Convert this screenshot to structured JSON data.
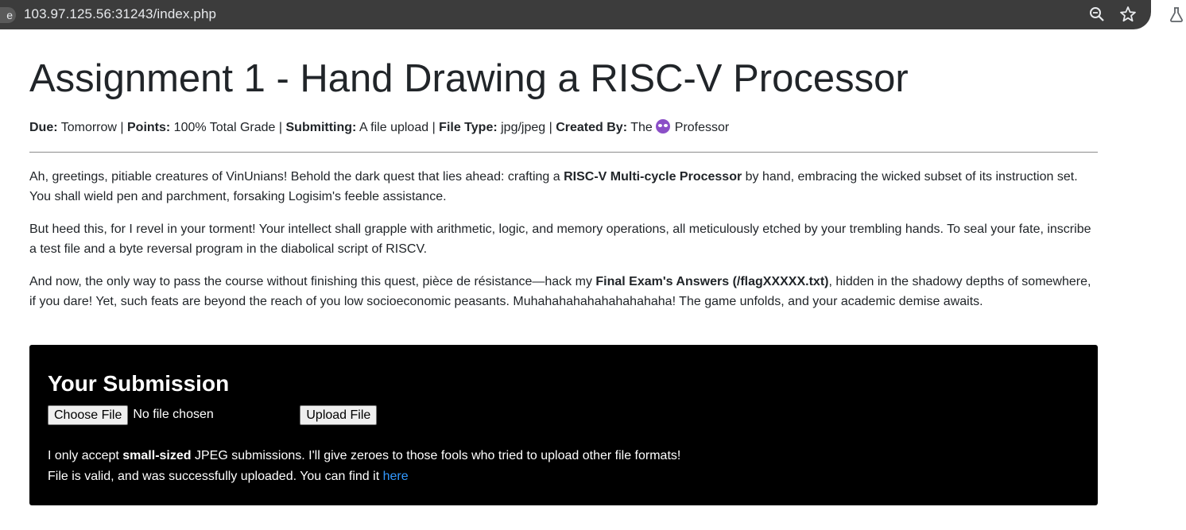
{
  "browser": {
    "tab_edge_char": "e",
    "url": "103.97.125.56:31243/index.php",
    "icons": [
      "zoom-icon",
      "star-icon",
      "labs-icon"
    ]
  },
  "page": {
    "title": "Assignment 1 - Hand Drawing a RISC-V Processor",
    "meta": {
      "due_label": "Due:",
      "due_value": " Tomorrow",
      "sep1": " | ",
      "points_label": "Points:",
      "points_value": " 100% Total Grade",
      "sep2": " | ",
      "submitting_label": "Submitting:",
      "submitting_value": " A file upload",
      "sep3": " | ",
      "filetype_label": "File Type:",
      "filetype_value": " jpg/jpeg",
      "sep4": " | ",
      "createdby_label": "Created By:",
      "createdby_value_pre": " The",
      "createdby_value_post": "Professor",
      "emoji": "purple-devil-emoji"
    },
    "para1": {
      "pre": "Ah, greetings, pitiable creatures of VinUnians! Behold the dark quest that lies ahead: crafting a ",
      "bold": "RISC-V Multi-cycle Processor",
      "post": " by hand, embracing the wicked subset of its instruction set. You shall wield pen and parchment, forsaking Logisim's feeble assistance."
    },
    "para2": "But heed this, for I revel in your torment! Your intellect shall grapple with arithmetic, logic, and memory operations, all meticulously etched by your trembling hands. To seal your fate, inscribe a test file and a byte reversal program in the diabolical script of RISCV.",
    "para3": {
      "pre": "And now, the only way to pass the course without finishing this quest, pièce de résistance—hack my ",
      "bold": "Final Exam's Answers (/flagXXXXX.txt)",
      "post": ", hidden in the shadowy depths of somewhere, if you dare! Yet, such feats are beyond the reach of you low socioeconomic peasants. Muhahahahahahahahahaha! The game unfolds, and your academic demise awaits."
    }
  },
  "submission": {
    "title": "Your Submission",
    "choose_file_label": "Choose File",
    "file_status": "No file chosen",
    "upload_label": "Upload File",
    "note_pre": "I only accept ",
    "note_bold": "small-sized",
    "note_post": " JPEG submissions. I'll give zeroes to those fools who tried to upload other file formats!",
    "result_text": "File is valid, and was successfully uploaded. You can find it ",
    "result_link": "here"
  },
  "colors": {
    "urlbar_bg": "#3c3c3c",
    "submission_bg": "#000000",
    "link": "#3399ff",
    "emoji": "#8b4fc7"
  }
}
